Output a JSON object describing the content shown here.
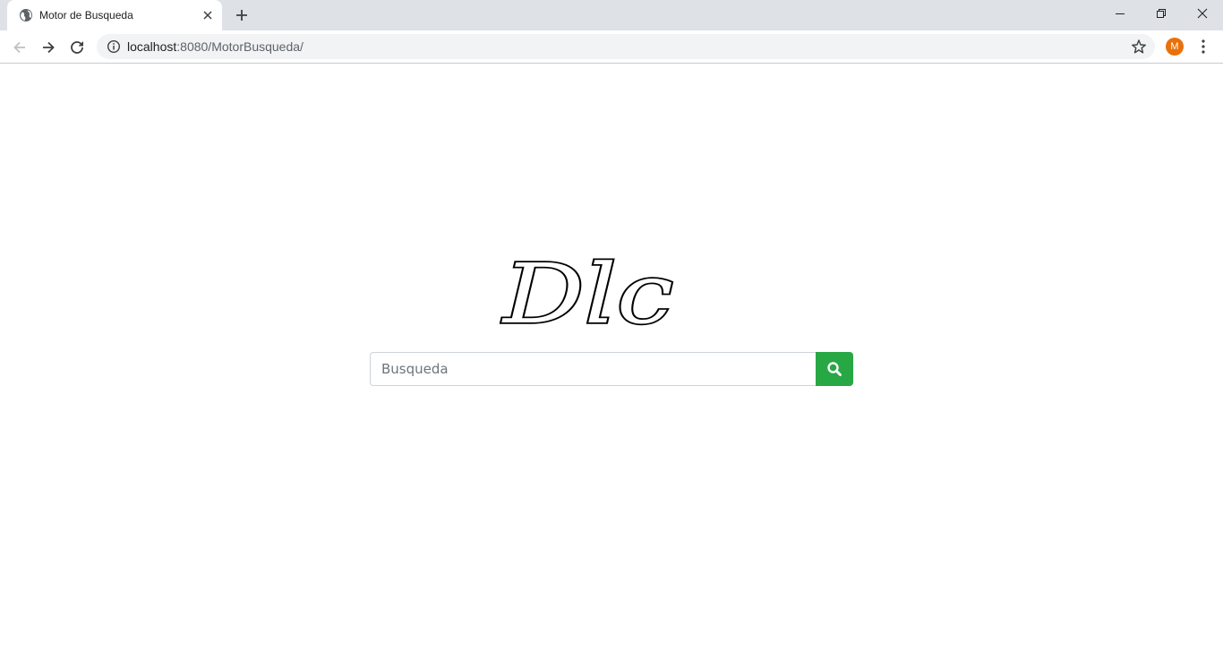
{
  "browser": {
    "tab": {
      "title": "Motor de Busqueda",
      "favicon": "globe-icon"
    },
    "address_bar": {
      "host": "localhost",
      "path": ":8080/MotorBusqueda/"
    },
    "profile": {
      "initial": "M",
      "color": "#e8710a"
    }
  },
  "page": {
    "logo": {
      "text": "Dlc"
    },
    "search": {
      "placeholder": "Busqueda",
      "value": "",
      "button_icon": "search-icon",
      "button_color": "#28a745"
    }
  }
}
